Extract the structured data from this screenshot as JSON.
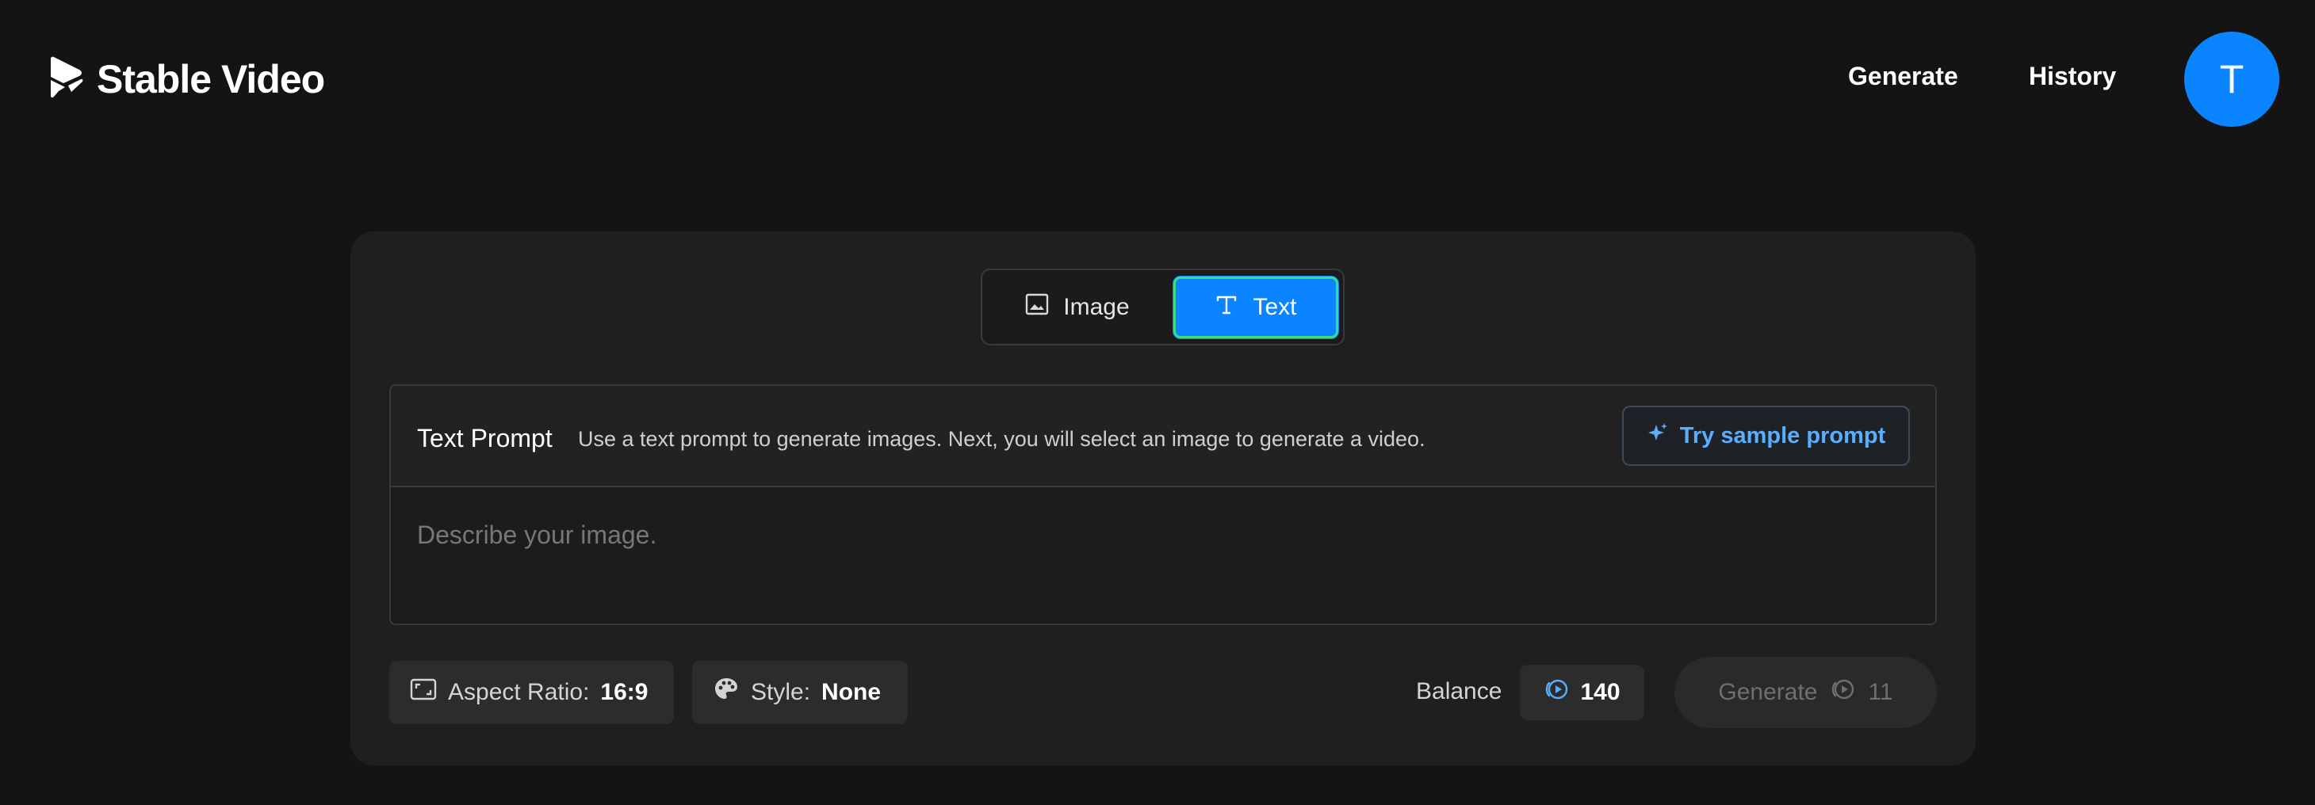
{
  "header": {
    "logo_text": "Stable Video",
    "nav": {
      "generate": "Generate",
      "history": "History"
    },
    "avatar_initial": "T"
  },
  "mode_toggle": {
    "image_label": "Image",
    "text_label": "Text",
    "selected": "Text"
  },
  "prompt": {
    "title": "Text Prompt",
    "description": "Use a text prompt to generate images. Next, you will select an image to generate a video.",
    "sample_button": "Try sample prompt",
    "placeholder": "Describe your image.",
    "value": ""
  },
  "options": {
    "aspect_ratio_label": "Aspect Ratio:",
    "aspect_ratio_value": "16:9",
    "style_label": "Style:",
    "style_value": "None"
  },
  "balance": {
    "label": "Balance",
    "value": "140"
  },
  "generate_button": {
    "label": "Generate",
    "cost": "11",
    "disabled": true
  },
  "colors": {
    "background": "#141414",
    "card": "#1f1f1f",
    "accent": "#0a84ff",
    "accent_text": "#5aaefc",
    "selected_outline": "#3ddc84"
  },
  "icons": {
    "logo": "stable-video-logo-icon",
    "image_mode": "image-icon",
    "text_mode": "text-t-icon",
    "sample": "sparkle-icon",
    "aspect": "aspect-ratio-icon",
    "style": "palette-icon",
    "credits": "credit-coin-icon"
  }
}
